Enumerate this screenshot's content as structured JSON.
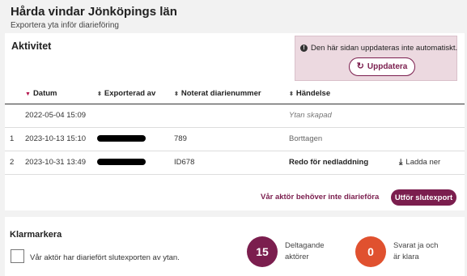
{
  "page": {
    "title": "Hårda vindar Jönköpings län",
    "subtitle": "Exportera yta inför diarieföring"
  },
  "activity": {
    "title": "Aktivitet",
    "notice": {
      "text": "Den här sidan uppdateras inte automatiskt.",
      "refresh_label": "Uppdatera",
      "info_icon": "info-icon",
      "refresh_icon": "refresh-icon"
    },
    "columns": {
      "date": "Datum",
      "exported_by": "Exporterad av",
      "diary_number": "Noterat diarienummer",
      "event": "Händelse"
    },
    "rows": [
      {
        "idx": "",
        "date": "2022-05-04 15:09",
        "exported_by_redacted": false,
        "diary_number": "",
        "event": "Ytan skapad",
        "event_style": "italic",
        "action": ""
      },
      {
        "idx": "1",
        "date": "2023-10-13 15:10",
        "exported_by_redacted": true,
        "diary_number": "789",
        "event": "Borttagen",
        "event_style": "muted",
        "action": ""
      },
      {
        "idx": "2",
        "date": "2023-10-31 13:49",
        "exported_by_redacted": true,
        "diary_number": "ID678",
        "event": "Redo för nedladdning",
        "event_style": "bold",
        "action": "Ladda ner"
      }
    ],
    "no_diary_label": "Vår aktör behöver inte diarieföra",
    "final_export_label": "Utför slutexport"
  },
  "klarmarkera": {
    "title": "Klarmarkera",
    "checkbox_label": "Vår aktör har diariefört slutexporten av ytan.",
    "checked": false,
    "stats": [
      {
        "value": "15",
        "label": "Deltagande aktörer",
        "color": "#7b1e4e"
      },
      {
        "value": "0",
        "label": "Svarat ja och är klara",
        "color": "#e0512f"
      }
    ]
  }
}
